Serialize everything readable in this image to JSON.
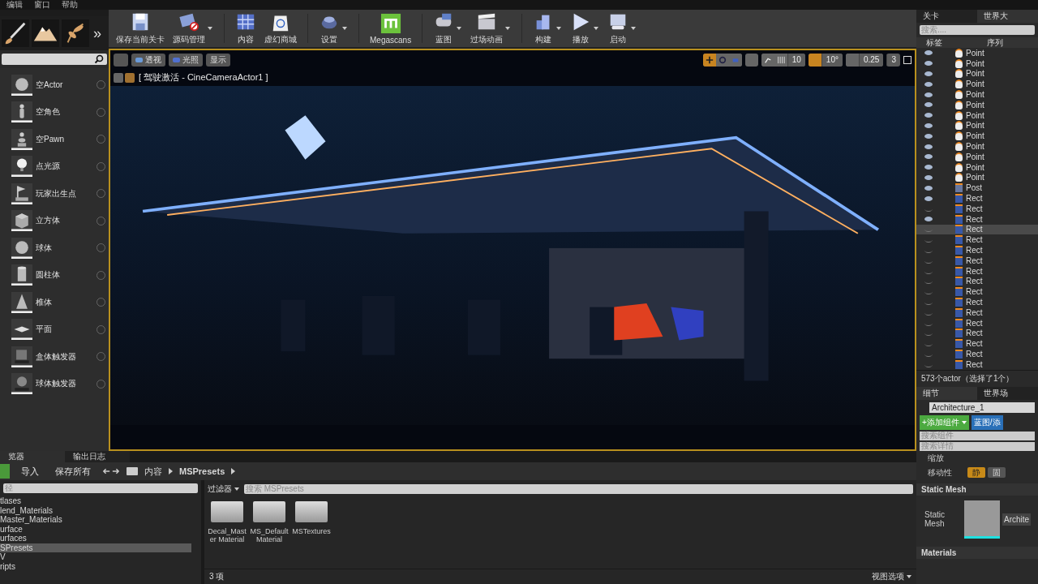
{
  "menu": [
    "编辑",
    "窗口",
    "帮助"
  ],
  "modes": {
    "more": "»",
    "items": [
      {
        "label": "空Actor",
        "kind": "sphere"
      },
      {
        "label": "空角色",
        "kind": "figure"
      },
      {
        "label": "空Pawn",
        "kind": "pawn"
      },
      {
        "label": "点光源",
        "kind": "bulb"
      },
      {
        "label": "玩家出生点",
        "kind": "flag"
      },
      {
        "label": "立方体",
        "kind": "cube"
      },
      {
        "label": "球体",
        "kind": "sphere"
      },
      {
        "label": "圆柱体",
        "kind": "cylinder"
      },
      {
        "label": "椎体",
        "kind": "cone"
      },
      {
        "label": "平面",
        "kind": "plane"
      },
      {
        "label": "盒体触发器",
        "kind": "box-trigger"
      },
      {
        "label": "球体触发器",
        "kind": "sphere-trigger"
      }
    ]
  },
  "toolbar": [
    {
      "label": "保存当前关卡",
      "kind": "save",
      "dropdown": false
    },
    {
      "label": "源码管理",
      "kind": "source",
      "dropdown": true
    },
    {
      "label": "内容",
      "kind": "content",
      "dropdown": false
    },
    {
      "label": "虚幻商城",
      "kind": "market",
      "dropdown": false
    },
    {
      "label": "设置",
      "kind": "settings",
      "dropdown": true
    },
    {
      "label": "Megascans",
      "kind": "megascans",
      "dropdown": false
    },
    {
      "label": "蓝图",
      "kind": "blueprint",
      "dropdown": true
    },
    {
      "label": "过场动画",
      "kind": "cinematic",
      "dropdown": true
    },
    {
      "label": "构建",
      "kind": "build",
      "dropdown": true
    },
    {
      "label": "播放",
      "kind": "play",
      "dropdown": true
    },
    {
      "label": "启动",
      "kind": "launch",
      "dropdown": true
    }
  ],
  "viewport": {
    "view_buttons": [
      {
        "label": "透视",
        "kind": "perspective"
      },
      {
        "label": "光照",
        "kind": "lit"
      },
      {
        "label": "显示",
        "kind": "show"
      }
    ],
    "title": "[ 驾驶激活 - CineCameraActor1 ]",
    "transform_modes": [
      {
        "kind": "move",
        "selected": true
      },
      {
        "kind": "rotate",
        "selected": false
      },
      {
        "kind": "scale",
        "selected": false
      }
    ],
    "grid_snap": {
      "value": "10",
      "on": false
    },
    "rotation_snap": {
      "value": "10°",
      "on": true
    },
    "scale_snap": {
      "value": "0.25",
      "on": false
    },
    "camera_speed": "3"
  },
  "outliner": {
    "tabs": [
      {
        "label": "关卡",
        "selected": false
      },
      {
        "label": "世界大",
        "selected": true
      }
    ],
    "search_placeholder": "搜索....",
    "columns": [
      "标签",
      "序列"
    ],
    "rows": [
      {
        "label": "Point",
        "kind": "light",
        "visible": true,
        "selected": false
      },
      {
        "label": "Point",
        "kind": "light",
        "visible": true,
        "selected": false
      },
      {
        "label": "Point",
        "kind": "light",
        "visible": true,
        "selected": false
      },
      {
        "label": "Point",
        "kind": "light",
        "visible": true,
        "selected": false
      },
      {
        "label": "Point",
        "kind": "light",
        "visible": true,
        "selected": false
      },
      {
        "label": "Point",
        "kind": "light",
        "visible": true,
        "selected": false
      },
      {
        "label": "Point",
        "kind": "light",
        "visible": true,
        "selected": false
      },
      {
        "label": "Point",
        "kind": "light",
        "visible": true,
        "selected": false
      },
      {
        "label": "Point",
        "kind": "light",
        "visible": true,
        "selected": false
      },
      {
        "label": "Point",
        "kind": "light",
        "visible": true,
        "selected": false
      },
      {
        "label": "Point",
        "kind": "light",
        "visible": true,
        "selected": false
      },
      {
        "label": "Point",
        "kind": "light",
        "visible": true,
        "selected": false
      },
      {
        "label": "Point",
        "kind": "light",
        "visible": true,
        "selected": false
      },
      {
        "label": "Post",
        "kind": "volume",
        "visible": true,
        "selected": false
      },
      {
        "label": "Rect",
        "kind": "rectlight",
        "visible": true,
        "selected": false
      },
      {
        "label": "Rect",
        "kind": "rectlight",
        "visible": false,
        "selected": false
      },
      {
        "label": "Rect",
        "kind": "rectlight",
        "visible": true,
        "selected": false
      },
      {
        "label": "Rect",
        "kind": "rectlight",
        "visible": false,
        "selected": true
      },
      {
        "label": "Rect",
        "kind": "rectlight",
        "visible": false,
        "selected": false
      },
      {
        "label": "Rect",
        "kind": "rectlight",
        "visible": false,
        "selected": false
      },
      {
        "label": "Rect",
        "kind": "rectlight",
        "visible": false,
        "selected": false
      },
      {
        "label": "Rect",
        "kind": "rectlight",
        "visible": false,
        "selected": false
      },
      {
        "label": "Rect",
        "kind": "rectlight",
        "visible": false,
        "selected": false
      },
      {
        "label": "Rect",
        "kind": "rectlight",
        "visible": false,
        "selected": false
      },
      {
        "label": "Rect",
        "kind": "rectlight",
        "visible": false,
        "selected": false
      },
      {
        "label": "Rect",
        "kind": "rectlight",
        "visible": false,
        "selected": false
      },
      {
        "label": "Rect",
        "kind": "rectlight",
        "visible": false,
        "selected": false
      },
      {
        "label": "Rect",
        "kind": "rectlight",
        "visible": false,
        "selected": false
      },
      {
        "label": "Rect",
        "kind": "rectlight",
        "visible": false,
        "selected": false
      },
      {
        "label": "Rect",
        "kind": "rectlight",
        "visible": false,
        "selected": false
      },
      {
        "label": "Rect",
        "kind": "rectlight",
        "visible": false,
        "selected": false
      }
    ],
    "status": "573个actor（选择了1个）"
  },
  "details": {
    "tabs": [
      {
        "label": "细节",
        "selected": true
      },
      {
        "label": "世界场",
        "selected": false
      }
    ],
    "name": "Architecture_1",
    "add_button": "+添加组件",
    "blueprint_button": "蓝图/添",
    "search_components": "搜索组件",
    "search_details": "搜索详情",
    "scale_label": "缩放",
    "mobility": {
      "label": "移动性",
      "options": [
        {
          "label": "静",
          "selected": true
        },
        {
          "label": "固",
          "selected": false
        }
      ]
    },
    "section": "Static Mesh",
    "property": "Static Mesh",
    "asset": "Archite",
    "next_section": "Materials"
  },
  "content_browser": {
    "tabs": [
      {
        "label": "览器",
        "selected": true
      },
      {
        "label": "输出日志",
        "selected": false
      }
    ],
    "import": "导入",
    "save_all": "保存所有",
    "breadcrumb": [
      "内容",
      "MSPresets"
    ],
    "path_placeholder": "径",
    "tree": [
      {
        "label": "tlases",
        "selected": false
      },
      {
        "label": "lend_Materials",
        "selected": false
      },
      {
        "label": "Master_Materials",
        "selected": false
      },
      {
        "label": "urface",
        "selected": false
      },
      {
        "label": "urfaces",
        "selected": false
      },
      {
        "label": "SPresets",
        "selected": true
      },
      {
        "label": "V",
        "selected": false
      },
      {
        "label": "ripts",
        "selected": false
      }
    ],
    "filter": "过滤器",
    "search_placeholder": "搜索 MSPresets",
    "assets": [
      {
        "label": "Decal_Master Material"
      },
      {
        "label": "MS_Default Material"
      },
      {
        "label": "MSTextures"
      }
    ],
    "count": "3 项",
    "view_options": "视图选项"
  }
}
